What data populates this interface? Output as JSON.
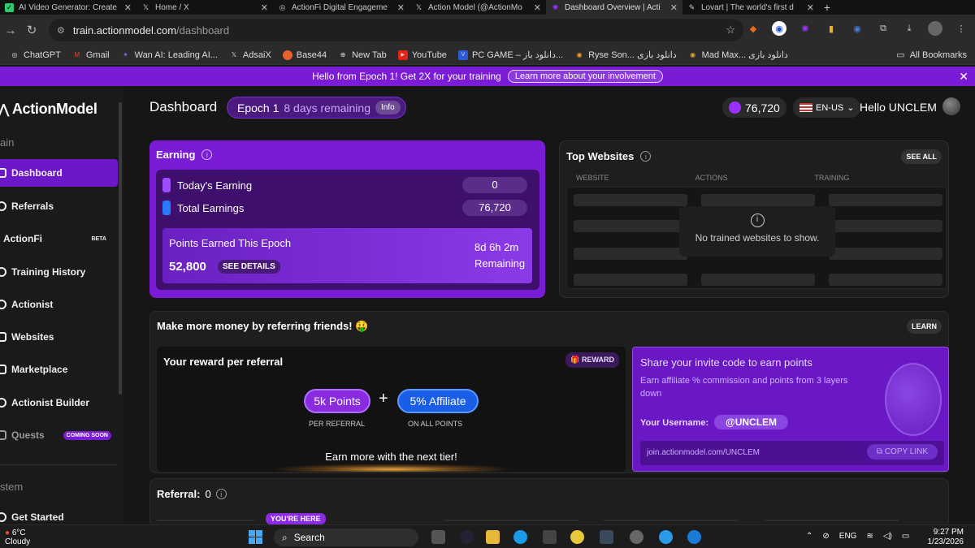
{
  "browser": {
    "tabs": [
      {
        "title": "AI Video Generator: Create",
        "icon_color": "#2ecc71"
      },
      {
        "title": "Home / X",
        "icon_color": "#ffffff"
      },
      {
        "title": "ActionFi Digital Engageme",
        "icon_color": "#bbbbbb"
      },
      {
        "title": "Action Model (@ActionMo",
        "icon_color": "#ffffff"
      },
      {
        "title": "Dashboard Overview | Acti",
        "icon_color": "#9b30ff"
      },
      {
        "title": "Lovart | The world's first d",
        "icon_color": "#ffffff"
      }
    ],
    "url_host": "train.actionmodel.com",
    "url_path": "/dashboard",
    "bookmarks": [
      "ChatGPT",
      "Gmail",
      "Wan AI: Leading AI...",
      "AdsaiX",
      "Base44",
      "New Tab",
      "YouTube",
      "PC GAME – دانلود باز...",
      "Ryse Son... دانلود بازی",
      "Mad Max... دانلود بازی"
    ],
    "all_bookmarks": "All Bookmarks"
  },
  "banner": {
    "text": "Hello from Epoch 1! Get 2X for your training",
    "link": "Learn more about your involvement",
    "close": "✕"
  },
  "sidebar": {
    "brand": "ActionModel",
    "section_main": "ain",
    "section_system": "stem",
    "items": [
      {
        "label": "Dashboard",
        "badge": ""
      },
      {
        "label": "Referrals",
        "badge": ""
      },
      {
        "label": "ActionFi",
        "badge": "BETA"
      },
      {
        "label": "Training History",
        "badge": ""
      },
      {
        "label": "Actionist",
        "badge": ""
      },
      {
        "label": "Websites",
        "badge": ""
      },
      {
        "label": "Marketplace",
        "badge": ""
      },
      {
        "label": "Actionist Builder",
        "badge": ""
      },
      {
        "label": "Quests",
        "badge": "COMING SOON"
      }
    ],
    "get_started": "Get Started"
  },
  "header": {
    "title": "Dashboard",
    "epoch": "Epoch 1",
    "epoch_remaining": "8 days remaining",
    "info": "Info",
    "points": "76,720",
    "lang": "EN-US",
    "greeting": "Hello UNCLEM"
  },
  "earning": {
    "title": "Earning",
    "today_label": "Today's Earning",
    "today_value": "0",
    "total_label": "Total Earnings",
    "total_value": "76,720",
    "epoch_points_label": "Points Earned This Epoch",
    "epoch_points_value": "52,800",
    "see_details": "SEE DETAILS",
    "time_left": "8d 6h 2m",
    "remaining": "Remaining"
  },
  "top_websites": {
    "title": "Top Websites",
    "see_all": "SEE ALL",
    "columns": [
      "WEBSITE",
      "ACTIONS",
      "TRAINING"
    ],
    "empty": "No trained websites to show."
  },
  "referral_promo": {
    "title": "Make more money by referring friends! 🤑",
    "learn": "LEARN",
    "reward_title": "Your reward per referral",
    "reward_badge": "REWARD",
    "points_pill": "5k Points",
    "affiliate_pill": "5% Affiliate",
    "plus": "+",
    "points_caption": "PER REFERRAL",
    "affiliate_caption": "ON ALL POINTS",
    "next_tier": "Earn more with the next tier!",
    "share_title": "Share your invite code to earn points",
    "share_desc": "Earn affiliate % commission and points from 3 layers down",
    "username_label": "Your Username:",
    "username": "@UNCLEM",
    "invite_link": "join.actionmodel.com/UNCLEM",
    "copy_link": "COPY LINK"
  },
  "referral_count": {
    "label": "Referral:",
    "value": "0",
    "youre_here": "YOU'RE HERE"
  },
  "taskbar": {
    "temp": "6°C",
    "weather": "Cloudy",
    "search": "Search",
    "lang": "ENG",
    "time": "9:27 PM",
    "date": "1/23/2026"
  }
}
